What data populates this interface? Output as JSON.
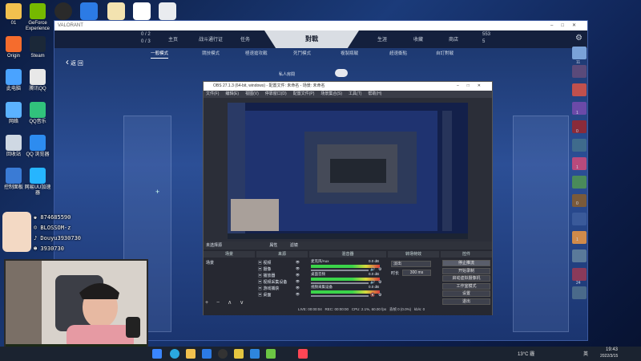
{
  "desktop_icons": [
    {
      "label": "01",
      "icon": "folder-icon",
      "color": "#f2c14e"
    },
    {
      "label": "GeForce Experience",
      "icon": "nvidia-icon",
      "color": "#76b900"
    },
    {
      "label": "Origin",
      "icon": "origin-icon",
      "color": "#f56c2d"
    },
    {
      "label": "Steam",
      "icon": "steam-icon",
      "color": "#1b2838"
    },
    {
      "label": "此电脑",
      "icon": "computer-icon",
      "color": "#4aa3ff"
    },
    {
      "label": "腾讯QQ",
      "icon": "qq-icon",
      "color": "#e8e8e8"
    },
    {
      "label": "网络",
      "icon": "network-icon",
      "color": "#5bb2ff"
    },
    {
      "label": "QQ音乐",
      "icon": "qqmusic-icon",
      "color": "#31c27c"
    },
    {
      "label": "回收站",
      "icon": "recycle-bin-icon",
      "color": "#cfd8e3"
    },
    {
      "label": "QQ 浏览器",
      "icon": "qq-browser-icon",
      "color": "#2d8cf0"
    },
    {
      "label": "控制面板",
      "icon": "control-panel-icon",
      "color": "#3a7bd5"
    },
    {
      "label": "网易UU加速器",
      "icon": "uu-icon",
      "color": "#26b5ff"
    }
  ],
  "valorant": {
    "window_title": "VALORANT",
    "counter_a": "0 / 2",
    "counter_b": "0 / 3",
    "nav_left": [
      "主页",
      "战斗通行证",
      "任务"
    ],
    "nav_center": "對戰",
    "nav_right": [
      "生涯",
      "收藏",
      "商店"
    ],
    "points_a": "553",
    "points_b": "5",
    "back_label": "返 回",
    "modes": [
      "一般模式",
      "競技模式",
      "極速搶攻戰",
      "死鬥模式",
      "複製瓶戰",
      "超速衝點",
      "自訂對戰"
    ],
    "private_label": "私人房間"
  },
  "friends_counts": [
    "11",
    "1",
    "0",
    "1",
    "0",
    "1",
    "24"
  ],
  "obs": {
    "title": "OBS 27.1.3 (64-bit, windows) - 配置文件: 未命名 - 场景: 未命名",
    "menu": [
      "文件(F)",
      "编辑(E)",
      "视图(V)",
      "停靠窗口(D)",
      "配置文件(P)",
      "场景集合(S)",
      "工具(T)",
      "帮助(H)"
    ],
    "scene_toolbar": [
      "未选择源",
      "属性",
      "滤镜"
    ],
    "headers": [
      "场景",
      "来源",
      "混音器",
      "转场特效",
      "控件"
    ],
    "scene_item": "场景",
    "sources": [
      "视频",
      "摄像",
      "播放器",
      "视频采集设备",
      "游戏捕获",
      "桌面"
    ],
    "mixer": [
      {
        "name": "麦克风/Aux",
        "db": "0.0 dB"
      },
      {
        "name": "桌面音频",
        "db": "0.0 dB"
      },
      {
        "name": "视频采集设备",
        "db": "0.0 dB"
      }
    ],
    "transition_type": "淡出",
    "duration_label": "时长",
    "duration_value": "300 ms",
    "controls": [
      "停止推流",
      "开始录制",
      "启动虚拟摄像机",
      "工作室模式",
      "设置",
      "退出"
    ],
    "status_live": "LIVE: 00:00:04",
    "status_rec": "REC: 00:00:00",
    "status_cpu": "CPU: 2.1%, 60.00 fps",
    "status_drop": "丢帧 0 (0.0%)",
    "status_kbps": "kb/s: 0"
  },
  "overlay": {
    "line1": "♚ 874685590",
    "line2": "☺ BLOSSOM-z",
    "line3": "♪ Douyu3930730",
    "line4": "☻ 3930730"
  },
  "taskbar": {
    "weather": "13°C 霾",
    "lang": "英",
    "time": "19:43",
    "date": "2022/3/15"
  }
}
